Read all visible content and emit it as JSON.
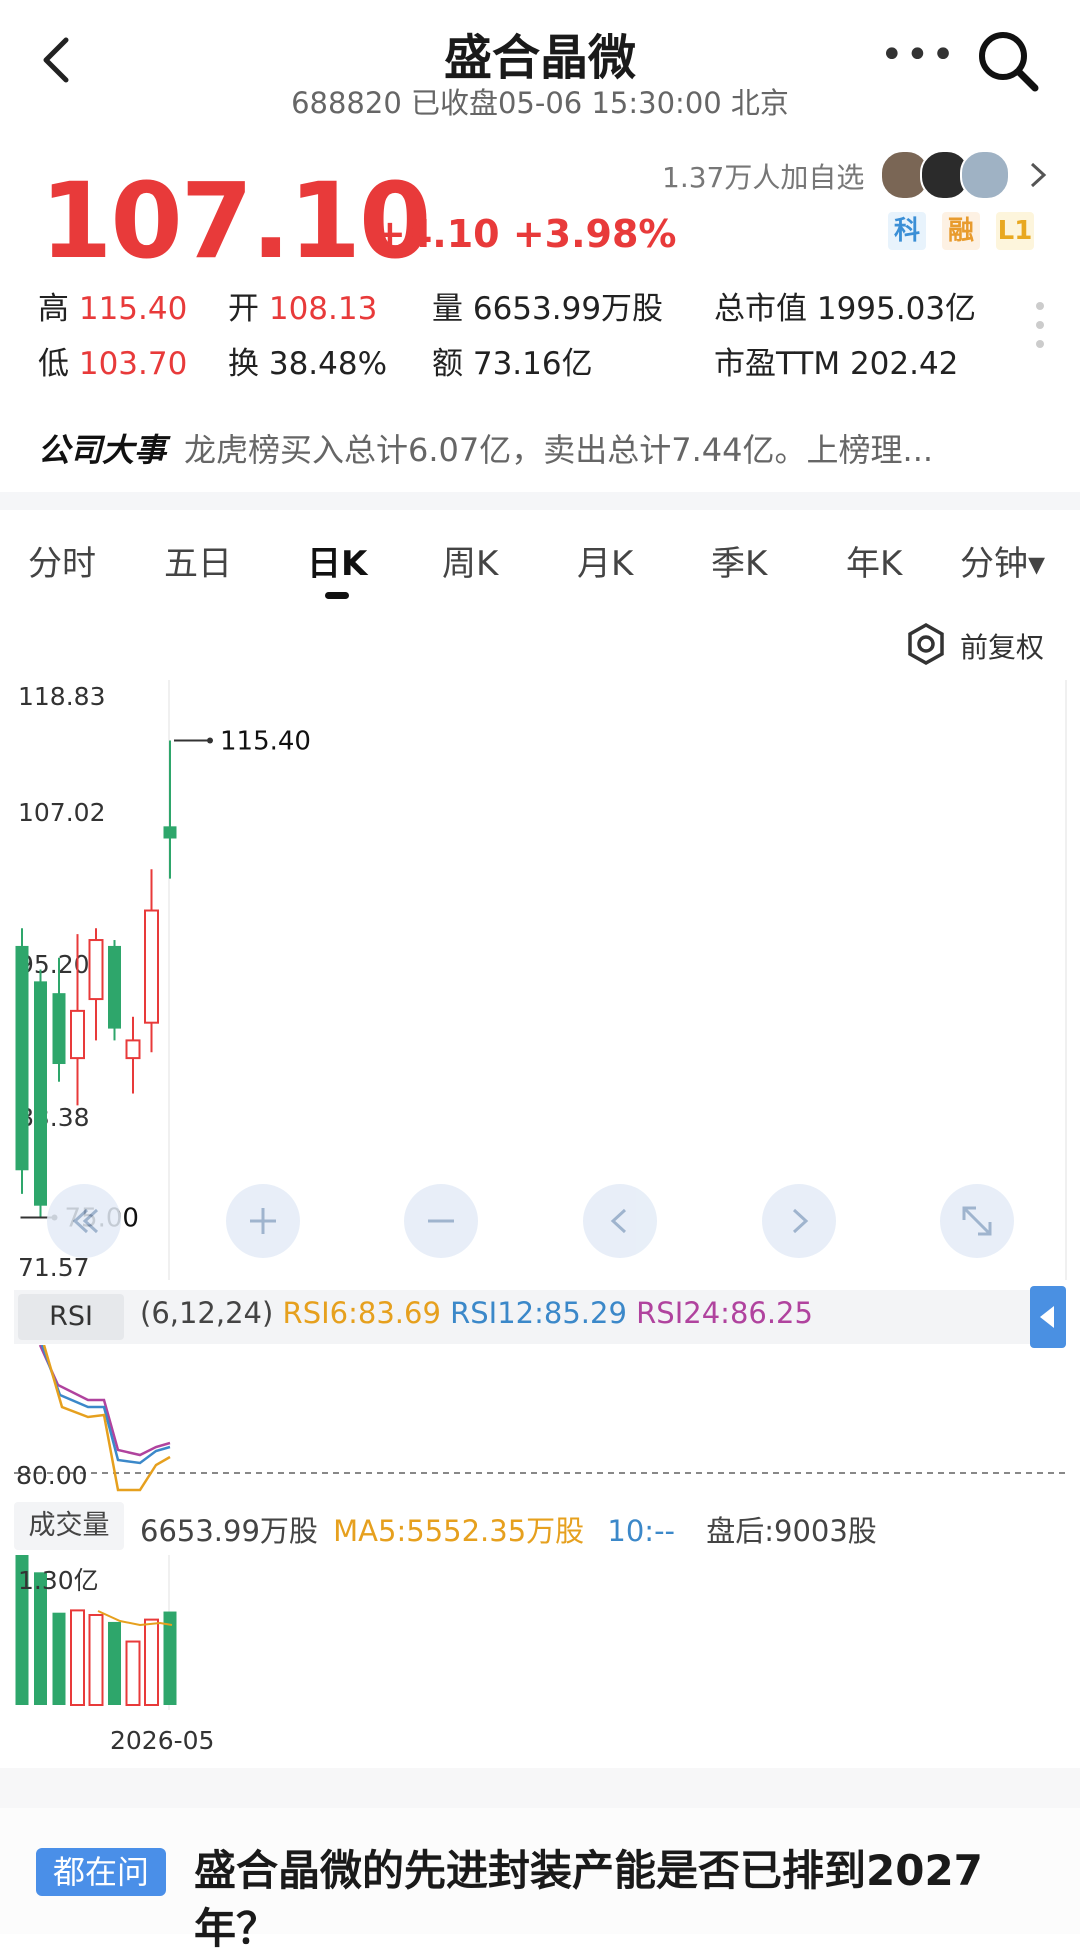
{
  "header": {
    "title": "盛合晶微",
    "subtitle": "688820 已收盘05-06 15:30:00 北京",
    "more_icon": "more-icon",
    "search_icon": "search-icon"
  },
  "quote": {
    "price": "107.10",
    "change": "+4.10 +3.98%",
    "watch_count": "1.37万人加自选",
    "badges": [
      "科",
      "融",
      "L1"
    ],
    "stats": {
      "high_label": "高",
      "high": "115.40",
      "open_label": "开",
      "open": "108.13",
      "volume_label": "量",
      "volume": "6653.99万股",
      "mcap_label": "总市值",
      "mcap": "1995.03亿",
      "low_label": "低",
      "low": "103.70",
      "turnover_label": "换",
      "turnover": "38.48%",
      "amount_label": "额",
      "amount": "73.16亿",
      "pe_label": "市盈TTM",
      "pe": "202.42"
    }
  },
  "event": {
    "label": "公司大事",
    "text": "龙虎榜买入总计6.07亿，卖出总计7.44亿。上榜理..."
  },
  "tabs": [
    "分时",
    "五日",
    "日K",
    "周K",
    "月K",
    "季K",
    "年K",
    "分钟▾"
  ],
  "active_tab": "日K",
  "adjust_label": "前复权",
  "chart_data": {
    "type": "candlestick",
    "y_ticks": [
      "118.83",
      "107.02",
      "95.20",
      "83.38",
      "71.57"
    ],
    "ylim": [
      71.57,
      118.83
    ],
    "high_marker": "115.40",
    "low_marker": "75.00",
    "candles": [
      {
        "open": 98.0,
        "close": 79.0,
        "high": 99.5,
        "low": 77.0
      },
      {
        "open": 95.0,
        "close": 76.0,
        "high": 96.0,
        "low": 75.0
      },
      {
        "open": 94.0,
        "close": 88.0,
        "high": 97.0,
        "low": 86.5
      },
      {
        "open": 88.5,
        "close": 92.5,
        "high": 99.0,
        "low": 84.5
      },
      {
        "open": 93.5,
        "close": 98.5,
        "high": 99.5,
        "low": 90.0
      },
      {
        "open": 98.0,
        "close": 91.0,
        "high": 98.5,
        "low": 90.0
      },
      {
        "open": 88.5,
        "close": 90.0,
        "high": 92.0,
        "low": 85.5
      },
      {
        "open": 91.5,
        "close": 101.0,
        "high": 104.5,
        "low": 89.0
      },
      {
        "open": 108.13,
        "close": 107.1,
        "high": 115.4,
        "low": 103.7
      }
    ],
    "rsi": {
      "label": "RSI",
      "params": "(6,12,24)",
      "rsi6": "RSI6:83.69",
      "rsi12": "RSI12:85.29",
      "rsi24": "RSI24:86.25",
      "ref_line": "80.00",
      "colors": {
        "rsi6": "#e6a01e",
        "rsi12": "#3b88c9",
        "rsi24": "#b0439e"
      }
    },
    "volume": {
      "label": "成交量",
      "value": "6653.99万股",
      "ma5": "MA5:5552.35万股",
      "ma10": "10:--",
      "after_hours": "盘后:9003股",
      "max_tick": "1.30亿",
      "bars": [
        1.3,
        1.15,
        0.8,
        0.82,
        0.78,
        0.72,
        0.55,
        0.74,
        0.81
      ]
    },
    "x_label": "2026-05"
  },
  "controls": [
    "double-left-icon",
    "zoom-in-icon",
    "zoom-out-icon",
    "left-icon",
    "right-icon",
    "expand-icon"
  ],
  "question": {
    "tag": "都在问",
    "text": "盛合晶微的先进封装产能是否已排到2027年？"
  },
  "colors": {
    "up": "#e83a3a",
    "down": "#2ea66b",
    "accent": "#4a90e2"
  }
}
